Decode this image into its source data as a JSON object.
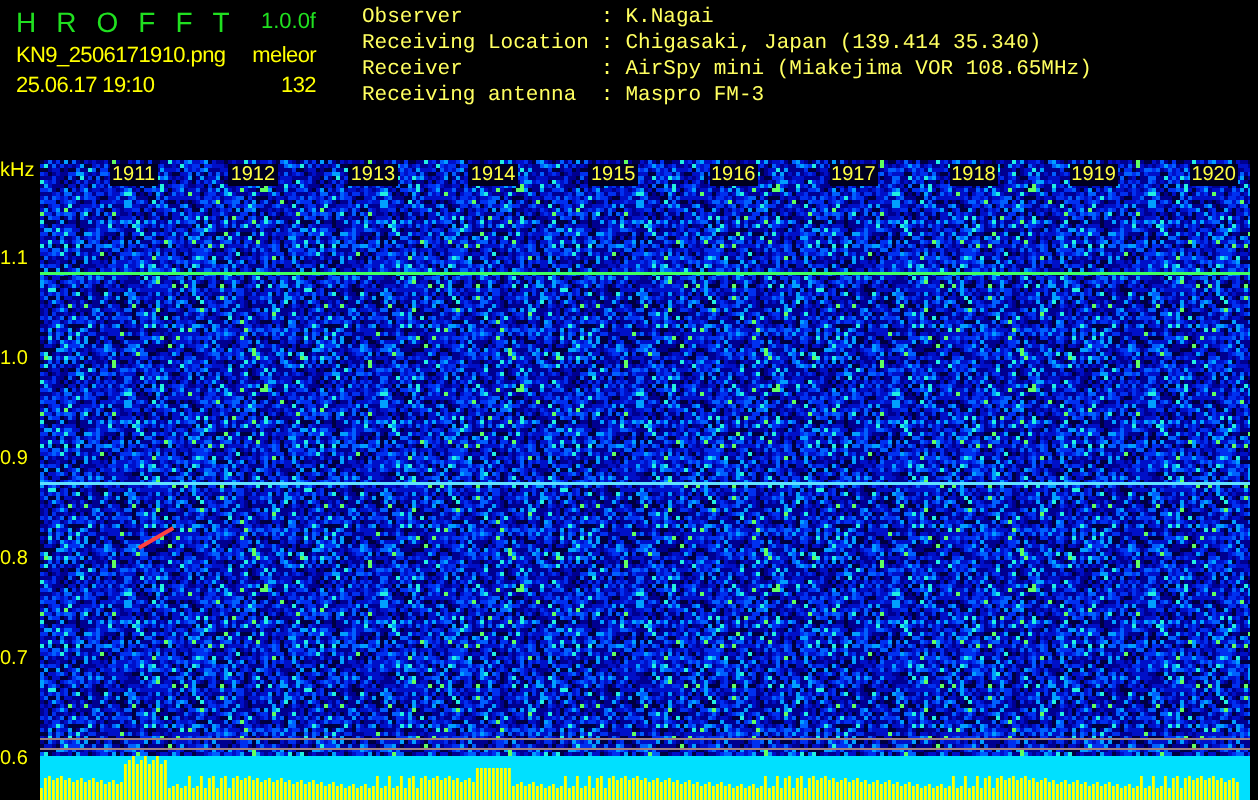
{
  "title_letters": [
    "H",
    "R",
    "O",
    "F",
    "F",
    "T"
  ],
  "version": "1.0.0f",
  "filename": "KN9_2506171910.png",
  "mode": "meleor",
  "datetime": "25.06.17 19:10",
  "count": "132",
  "info": [
    {
      "label": "Observer",
      "separator": ":",
      "value": "K.Nagai"
    },
    {
      "label": "Receiving Location",
      "separator": ":",
      "value": "Chigasaki, Japan (139.414 35.340)"
    },
    {
      "label": "Receiver",
      "separator": ":",
      "value": "AirSpy mini (Miakejima VOR 108.65MHz)"
    },
    {
      "label": "Receiving antenna",
      "separator": ":",
      "value": "Maspro FM-3"
    }
  ],
  "y_unit": "kHz",
  "y_labels": [
    "1.1",
    "1.0",
    "0.9",
    "0.8",
    "0.7",
    "0.6"
  ],
  "time_labels": [
    "1911",
    "1912",
    "1913",
    "1914",
    "1915",
    "1916",
    "1917",
    "1918",
    "1919",
    "1920"
  ]
}
